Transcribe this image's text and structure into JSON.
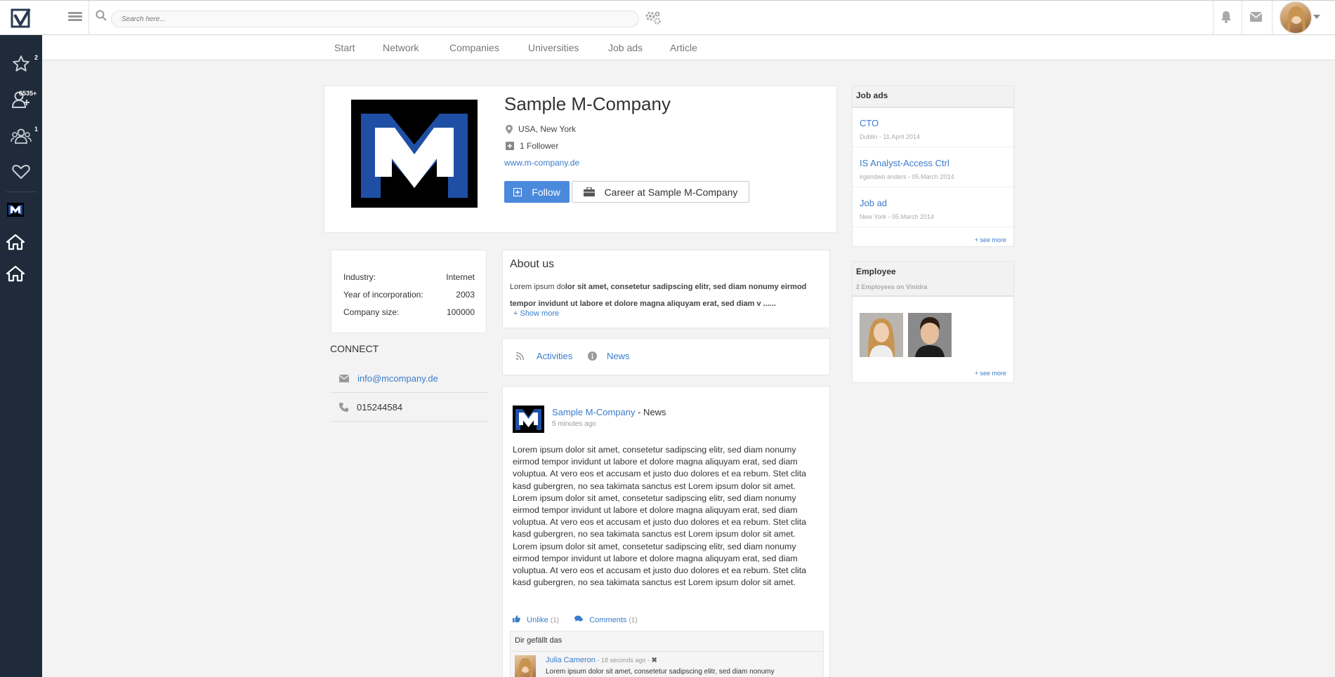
{
  "topbar": {
    "search_placeholder": "Search here..."
  },
  "sidebar": {
    "items": [
      {
        "icon": "star-icon",
        "badge": "2"
      },
      {
        "icon": "add-user-icon",
        "badge": "6535+"
      },
      {
        "icon": "group-icon",
        "badge": "1"
      },
      {
        "icon": "heart-icon",
        "badge": ""
      },
      {
        "icon": "company-logo-icon",
        "badge": ""
      },
      {
        "icon": "home-icon",
        "badge": ""
      },
      {
        "icon": "home-icon",
        "badge": ""
      }
    ]
  },
  "subnav": {
    "items": [
      "Start",
      "Network",
      "Companies",
      "Universities",
      "Job ads",
      "Article"
    ]
  },
  "company": {
    "name": "Sample M-Company",
    "location": "USA, New York",
    "followers": "1 Follower",
    "website": "www.m-company.de",
    "follow_label": "Follow",
    "career_label": "Career at Sample M-Company"
  },
  "info": {
    "rows": [
      {
        "label": "Industry:",
        "value": "Internet"
      },
      {
        "label": "Year of incorporation:",
        "value": "2003"
      },
      {
        "label": "Company size:",
        "value": "100000"
      }
    ]
  },
  "connect": {
    "title": "CONNECT",
    "email": "info@mcompany.de",
    "phone": "015244584"
  },
  "about": {
    "title": "About us",
    "text_start": "Lorem ipsum do",
    "text_bold": "lor sit amet, consetetur sadipscing elitr, sed diam nonumy eirmod tempor invidunt ut labore et dolore magna aliquyam erat, sed diam v ......",
    "show_more": "+ Show more"
  },
  "tabs": {
    "activities": "Activities",
    "news": "News"
  },
  "post": {
    "author": "Sample M-Company",
    "type_suffix": " - News",
    "time": "5 minutes ago",
    "body": "Lorem ipsum dolor sit amet, consetetur sadipscing elitr, sed diam nonumy eirmod tempor invidunt ut labore et dolore magna aliquyam erat, sed diam voluptua. At vero eos et accusam et justo duo dolores et ea rebum. Stet clita kasd gubergren, no sea takimata sanctus est Lorem ipsum dolor sit amet. Lorem ipsum dolor sit amet, consetetur sadipscing elitr, sed diam nonumy eirmod tempor invidunt ut labore et dolore magna aliquyam erat, sed diam voluptua. At vero eos et accusam et justo duo dolores et ea rebum. Stet clita kasd gubergren, no sea takimata sanctus est Lorem ipsum dolor sit amet. Lorem ipsum dolor sit amet, consetetur sadipscing elitr, sed diam nonumy eirmod tempor invidunt ut labore et dolore magna aliquyam erat, sed diam voluptua. At vero eos et accusam et justo duo dolores et ea rebum. Stet clita kasd gubergren, no sea takimata sanctus est Lorem ipsum dolor sit amet.",
    "unlike_label": "Unlike",
    "unlike_count": "(1)",
    "comments_label": "Comments",
    "comments_count": "(1)",
    "likes_text": "Dir gefällt das",
    "comment": {
      "author": "Julia Cameron",
      "meta": " - 18 seconds ago - ",
      "text": "Lorem ipsum dolor sit amet, consetetur sadipscing elitr, sed diam nonumy"
    }
  },
  "jobs": {
    "title": "Job ads",
    "items": [
      {
        "title": "CTO",
        "meta": "Dublin - 11.April 2014"
      },
      {
        "title": "IS Analyst-Access Ctrl",
        "meta": "irgendwo anders - 05.March 2014"
      },
      {
        "title": "Job ad",
        "meta": "New York - 05.March 2014"
      }
    ],
    "see_more": "+ see more"
  },
  "employee": {
    "title": "Employee",
    "subtitle": "2 Employees on Vinidra",
    "see_more": "+ see more"
  },
  "colors": {
    "sidebar_bg": "#1f2b3a",
    "accent": "#4a89dc",
    "link": "#3a7ccc"
  }
}
